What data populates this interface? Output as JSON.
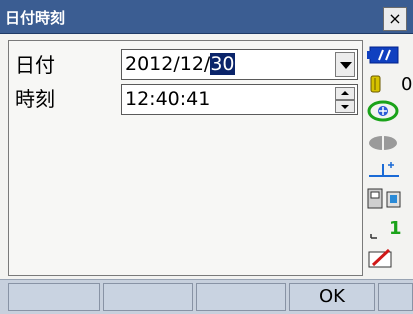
{
  "window": {
    "title": "日付時刻",
    "close_label": "×"
  },
  "form": {
    "date_label": "日付",
    "date_value_prefix": "2012/12/",
    "date_value_selected": "30",
    "time_label": "時刻",
    "time_value": "12:40:41"
  },
  "status": {
    "counter_value": "0",
    "page_indicator": "1"
  },
  "function_keys": [
    "",
    "",
    "",
    "OK",
    ""
  ],
  "icons": {
    "battery": "battery-icon",
    "signal": "signal-icon",
    "target": "target-icon",
    "tilt": "tilt-icon",
    "level": "level-icon",
    "device": "device-icon",
    "page": "page-indicator-icon",
    "pen": "pen-icon"
  },
  "colors": {
    "titlebar": "#3b5d92",
    "selection": "#0a246a",
    "funcbar": "#c7d0dd"
  }
}
